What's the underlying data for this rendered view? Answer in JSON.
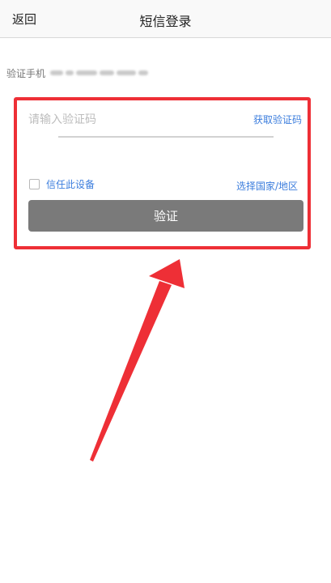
{
  "header": {
    "back_label": "返回",
    "title": "短信登录"
  },
  "phone": {
    "label": "验证手机"
  },
  "form": {
    "code_placeholder": "请输入验证码",
    "get_code_label": "获取验证码",
    "trust_device_label": "信任此设备",
    "trust_device_checked": false,
    "select_country_label": "选择国家/地区",
    "verify_button_label": "验证"
  },
  "annotation": {
    "highlight_color": "#ee2f36"
  }
}
